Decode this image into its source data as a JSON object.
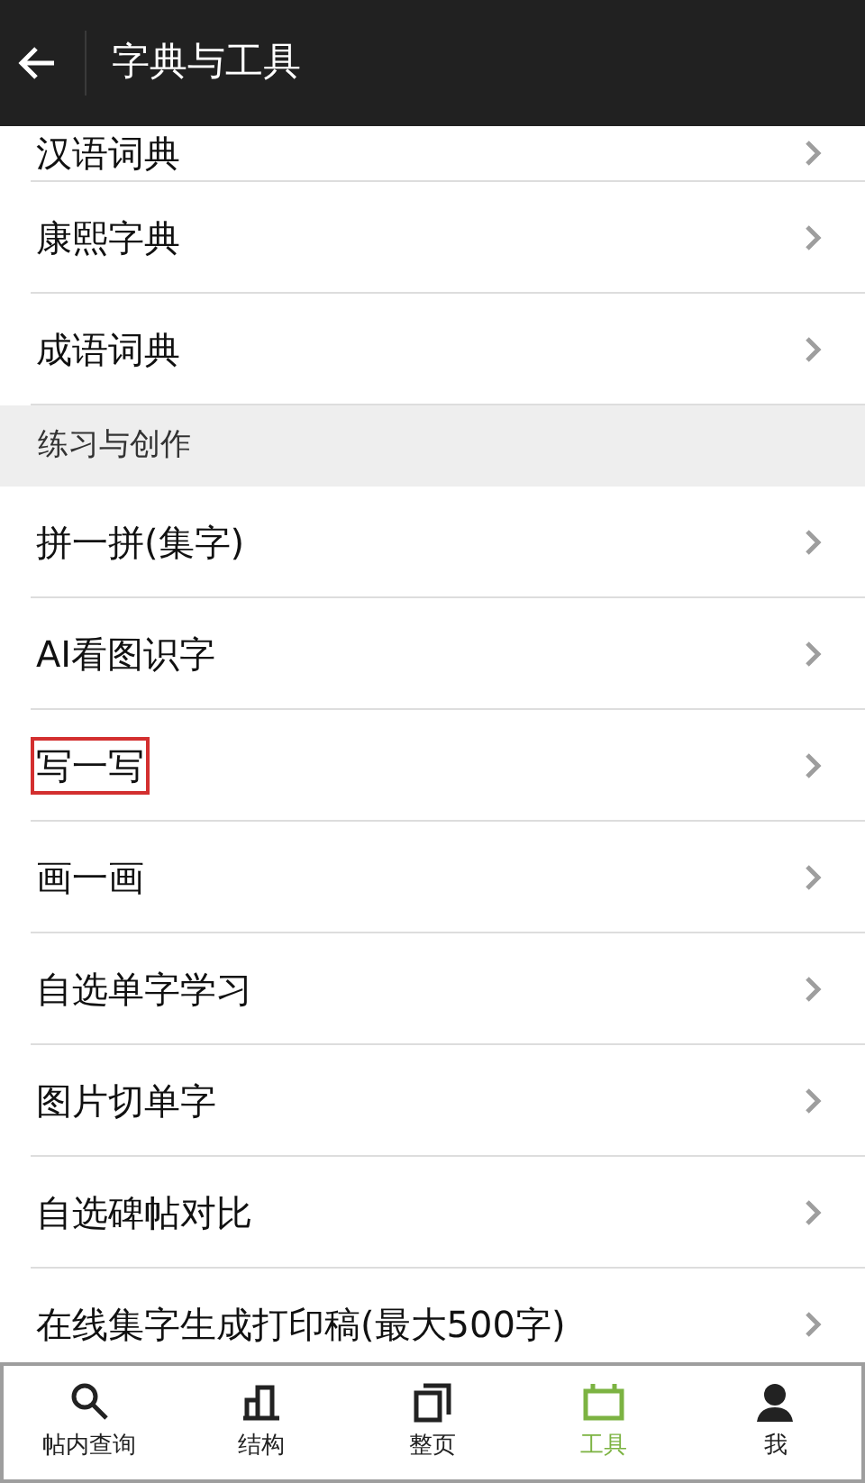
{
  "header": {
    "title": "字典与工具"
  },
  "list": [
    {
      "kind": "row",
      "label": "汉语词典",
      "highlighted": false
    },
    {
      "kind": "row",
      "label": "康熙字典",
      "highlighted": false
    },
    {
      "kind": "row",
      "label": "成语词典",
      "highlighted": false
    },
    {
      "kind": "section",
      "label": "练习与创作"
    },
    {
      "kind": "row",
      "label": "拼一拼(集字)",
      "highlighted": false
    },
    {
      "kind": "row",
      "label": "AI看图识字",
      "highlighted": false
    },
    {
      "kind": "row",
      "label": "写一写",
      "highlighted": true
    },
    {
      "kind": "row",
      "label": "画一画",
      "highlighted": false
    },
    {
      "kind": "row",
      "label": "自选单字学习",
      "highlighted": false
    },
    {
      "kind": "row",
      "label": "图片切单字",
      "highlighted": false
    },
    {
      "kind": "row",
      "label": "自选碑帖对比",
      "highlighted": false
    },
    {
      "kind": "row",
      "label": "在线集字生成打印稿(最大500字)",
      "highlighted": false
    }
  ],
  "bottom_nav": [
    {
      "label": "帖内查询",
      "selected": false
    },
    {
      "label": "结构",
      "selected": false
    },
    {
      "label": "整页",
      "selected": false
    },
    {
      "label": "工具",
      "selected": true
    },
    {
      "label": "我",
      "selected": false
    }
  ]
}
